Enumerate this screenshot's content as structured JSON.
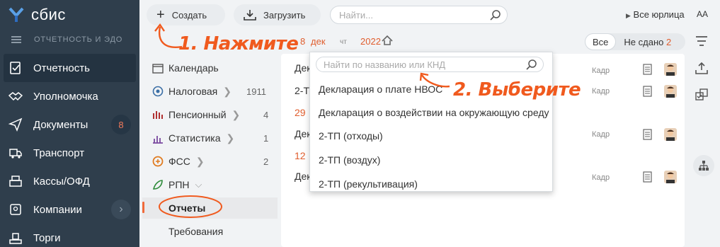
{
  "sidebar": {
    "logo": "сбис",
    "subtitle": "ОТЧЕТНОСТЬ И ЭДО",
    "items": [
      {
        "label": "Отчетность"
      },
      {
        "label": "Уполномочка"
      },
      {
        "label": "Документы",
        "badge": "8"
      },
      {
        "label": "Транспорт"
      },
      {
        "label": "Кассы/ОФД"
      },
      {
        "label": "Компании",
        "chevron": "›"
      },
      {
        "label": "Торги"
      }
    ]
  },
  "toolbar": {
    "create_label": "Создать",
    "upload_label": "Загрузить",
    "search_placeholder": "Найти...",
    "org_label": "Все юрлица",
    "font_label": "AA"
  },
  "date": {
    "day": "8",
    "month": "дек",
    "weekday": "чт",
    "year": "2022"
  },
  "filter": {
    "all": "Все",
    "not_submitted": "Не сдано",
    "not_submitted_count": "2"
  },
  "categories": [
    {
      "label": "Календарь",
      "count": ""
    },
    {
      "label": "Налоговая",
      "count": "1911"
    },
    {
      "label": "Пенсионный",
      "count": "4"
    },
    {
      "label": "Статистика",
      "count": "1"
    },
    {
      "label": "ФСС",
      "count": "2"
    },
    {
      "label": "РПН",
      "count": ""
    },
    {
      "label": "Отчеты",
      "count": ""
    },
    {
      "label": "Требования",
      "count": ""
    }
  ],
  "rows": [
    {
      "text": "Дек",
      "tag": "Кадр"
    },
    {
      "text": "2-Т",
      "tag": "Кадр"
    },
    {
      "text": "29",
      "tag": ""
    },
    {
      "text": "Дек",
      "tag": "Кадр"
    },
    {
      "text": "12",
      "tag": ""
    },
    {
      "text": "Дек",
      "tag": "Кадр"
    }
  ],
  "dropdown": {
    "search_placeholder": "Найти по названию или КНД",
    "items": [
      "Декларация о плате НВОС",
      "Декларация о воздействии на окружающую среду",
      "2-ТП (отходы)",
      "2-ТП (воздух)",
      "2-ТП (рекультивация)"
    ]
  },
  "annotations": {
    "step1": "1. Нажмите",
    "step2": "2. Выберите"
  },
  "colors": {
    "sidebar": "#2f3e4c",
    "accent": "#f05a1e",
    "date": "#e05d2d"
  }
}
